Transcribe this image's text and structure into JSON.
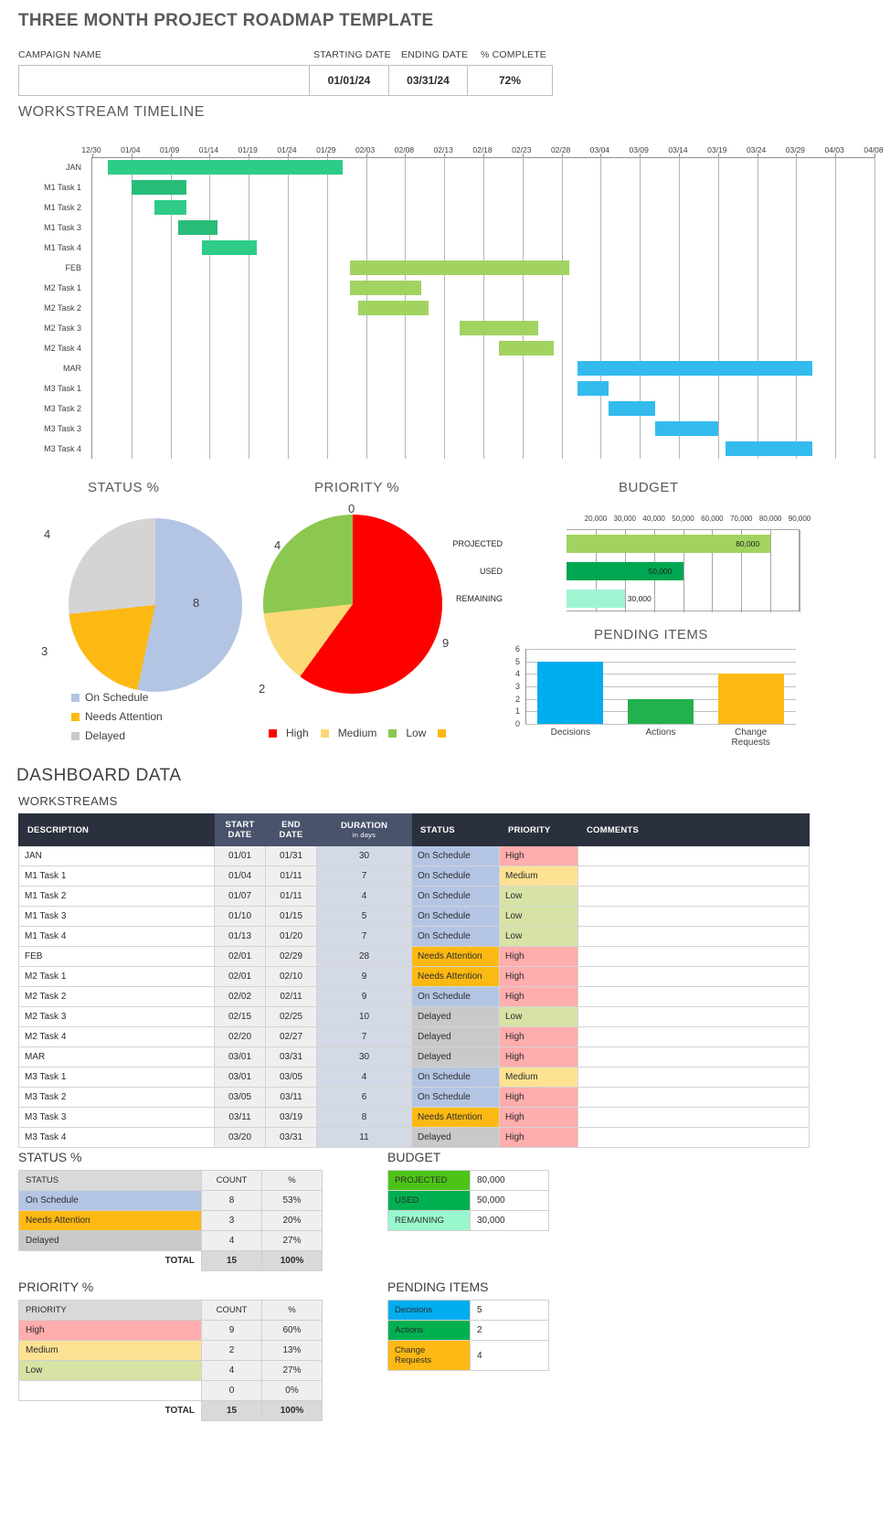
{
  "header": {
    "title": "THREE MONTH PROJECT ROADMAP TEMPLATE",
    "campaign_label": "CAMPAIGN NAME",
    "campaign_value": "",
    "start_label": "STARTING DATE",
    "start_value": "01/01/24",
    "end_label": "ENDING DATE",
    "end_value": "03/31/24",
    "pct_label": "% COMPLETE",
    "pct_value": "72%"
  },
  "workstream_timeline": {
    "title": "WORKSTREAM TIMELINE"
  },
  "dashboard": {
    "title": "DASHBOARD DATA",
    "workstreams_label": "WORKSTREAMS"
  },
  "workstreams_table": {
    "columns": [
      "DESCRIPTION",
      "START DATE",
      "END DATE",
      "DURATION",
      "STATUS",
      "PRIORITY",
      "COMMENTS"
    ],
    "duration_sub": "in days",
    "rows": [
      {
        "desc": "JAN",
        "start": "01/01",
        "end": "01/31",
        "dur": "30",
        "status": "On Schedule",
        "priority": "High",
        "comments": ""
      },
      {
        "desc": "M1 Task 1",
        "start": "01/04",
        "end": "01/11",
        "dur": "7",
        "status": "On Schedule",
        "priority": "Medium",
        "comments": ""
      },
      {
        "desc": "M1 Task 2",
        "start": "01/07",
        "end": "01/11",
        "dur": "4",
        "status": "On Schedule",
        "priority": "Low",
        "comments": ""
      },
      {
        "desc": "M1 Task 3",
        "start": "01/10",
        "end": "01/15",
        "dur": "5",
        "status": "On Schedule",
        "priority": "Low",
        "comments": ""
      },
      {
        "desc": "M1 Task 4",
        "start": "01/13",
        "end": "01/20",
        "dur": "7",
        "status": "On Schedule",
        "priority": "Low",
        "comments": ""
      },
      {
        "desc": "FEB",
        "start": "02/01",
        "end": "02/29",
        "dur": "28",
        "status": "Needs Attention",
        "priority": "High",
        "comments": ""
      },
      {
        "desc": "M2 Task 1",
        "start": "02/01",
        "end": "02/10",
        "dur": "9",
        "status": "Needs Attention",
        "priority": "High",
        "comments": ""
      },
      {
        "desc": "M2 Task 2",
        "start": "02/02",
        "end": "02/11",
        "dur": "9",
        "status": "On Schedule",
        "priority": "High",
        "comments": ""
      },
      {
        "desc": "M2 Task 3",
        "start": "02/15",
        "end": "02/25",
        "dur": "10",
        "status": "Delayed",
        "priority": "Low",
        "comments": ""
      },
      {
        "desc": "M2 Task 4",
        "start": "02/20",
        "end": "02/27",
        "dur": "7",
        "status": "Delayed",
        "priority": "High",
        "comments": ""
      },
      {
        "desc": "MAR",
        "start": "03/01",
        "end": "03/31",
        "dur": "30",
        "status": "Delayed",
        "priority": "High",
        "comments": ""
      },
      {
        "desc": "M3 Task 1",
        "start": "03/01",
        "end": "03/05",
        "dur": "4",
        "status": "On Schedule",
        "priority": "Medium",
        "comments": ""
      },
      {
        "desc": "M3 Task 2",
        "start": "03/05",
        "end": "03/11",
        "dur": "6",
        "status": "On Schedule",
        "priority": "High",
        "comments": ""
      },
      {
        "desc": "M3 Task 3",
        "start": "03/11",
        "end": "03/19",
        "dur": "8",
        "status": "Needs Attention",
        "priority": "High",
        "comments": ""
      },
      {
        "desc": "M3 Task 4",
        "start": "03/20",
        "end": "03/31",
        "dur": "11",
        "status": "Delayed",
        "priority": "High",
        "comments": ""
      }
    ]
  },
  "status_table": {
    "title": "STATUS %",
    "columns": [
      "STATUS",
      "COUNT",
      "%"
    ],
    "rows": [
      {
        "label": "On Schedule",
        "count": "8",
        "pct": "53%",
        "color": "#b4c5e4"
      },
      {
        "label": "Needs Attention",
        "count": "3",
        "pct": "20%",
        "color": "#fdb913"
      },
      {
        "label": "Delayed",
        "count": "4",
        "pct": "27%",
        "color": "#c9c9c9"
      }
    ],
    "total_label": "TOTAL",
    "total_count": "15",
    "total_pct": "100%"
  },
  "priority_table": {
    "title": "PRIORITY %",
    "columns": [
      "PRIORITY",
      "COUNT",
      "%"
    ],
    "rows": [
      {
        "label": "High",
        "count": "9",
        "pct": "60%",
        "color": "#ffadad"
      },
      {
        "label": "Medium",
        "count": "2",
        "pct": "13%",
        "color": "#fde293"
      },
      {
        "label": "Low",
        "count": "4",
        "pct": "27%",
        "color": "#d6e3a5"
      },
      {
        "label": "",
        "count": "0",
        "pct": "0%",
        "color": "#ffffff"
      }
    ],
    "total_label": "TOTAL",
    "total_count": "15",
    "total_pct": "100%"
  },
  "budget_table": {
    "title": "BUDGET",
    "rows": [
      {
        "label": "PROJECTED",
        "value": "80,000",
        "color": "#4cc417"
      },
      {
        "label": "USED",
        "value": "50,000",
        "color": "#00b050"
      },
      {
        "label": "REMAINING",
        "value": "30,000",
        "color": "#99f7cd"
      }
    ]
  },
  "pending_table": {
    "title": "PENDING ITEMS",
    "rows": [
      {
        "label": "Decisions",
        "value": "5",
        "color": "#00adef"
      },
      {
        "label": "Actions",
        "value": "2",
        "color": "#00b050"
      },
      {
        "label": "Change Requests",
        "value": "4",
        "color": "#fdb913"
      }
    ]
  },
  "chart_data": [
    {
      "type": "bar",
      "name": "workstream-timeline-gantt",
      "title": "WORKSTREAM TIMELINE",
      "orientation": "horizontal-gantt",
      "xlabel": "",
      "ylabel": "",
      "axis_ticks": [
        "12/30",
        "01/04",
        "01/09",
        "01/14",
        "01/19",
        "01/24",
        "01/29",
        "02/03",
        "02/08",
        "02/13",
        "02/18",
        "02/23",
        "02/28",
        "03/04",
        "03/09",
        "03/14",
        "03/19",
        "03/24",
        "03/29",
        "04/03",
        "04/08"
      ],
      "axis_start": "12/30",
      "axis_end": "04/08",
      "axis_day_span": 100,
      "grid": true,
      "categories": [
        "JAN",
        "M1 Task 1",
        "M1 Task 2",
        "M1 Task 3",
        "M1 Task 4",
        "FEB",
        "M2 Task 1",
        "M2 Task 2",
        "M2 Task 3",
        "M2 Task 4",
        "MAR",
        "M3 Task 1",
        "M3 Task 2",
        "M3 Task 3",
        "M3 Task 4"
      ],
      "bars": [
        {
          "label": "JAN",
          "start_day": 2,
          "duration": 30,
          "color": "#2ecc86"
        },
        {
          "label": "M1 Task 1",
          "start_day": 5,
          "duration": 7,
          "color": "#27bd78"
        },
        {
          "label": "M1 Task 2",
          "start_day": 8,
          "duration": 4,
          "color": "#2ecc86"
        },
        {
          "label": "M1 Task 3",
          "start_day": 11,
          "duration": 5,
          "color": "#27bd78"
        },
        {
          "label": "M1 Task 4",
          "start_day": 14,
          "duration": 7,
          "color": "#2ecc86"
        },
        {
          "label": "FEB",
          "start_day": 33,
          "duration": 28,
          "color": "#a2d360"
        },
        {
          "label": "M2 Task 1",
          "start_day": 33,
          "duration": 9,
          "color": "#a2d360"
        },
        {
          "label": "M2 Task 2",
          "start_day": 34,
          "duration": 9,
          "color": "#a2d360"
        },
        {
          "label": "M2 Task 3",
          "start_day": 47,
          "duration": 10,
          "color": "#a2d360"
        },
        {
          "label": "M2 Task 4",
          "start_day": 52,
          "duration": 7,
          "color": "#a2d360"
        },
        {
          "label": "MAR",
          "start_day": 62,
          "duration": 30,
          "color": "#33bbed"
        },
        {
          "label": "M3 Task 1",
          "start_day": 62,
          "duration": 4,
          "color": "#33bbed"
        },
        {
          "label": "M3 Task 2",
          "start_day": 66,
          "duration": 6,
          "color": "#33bbed"
        },
        {
          "label": "M3 Task 3",
          "start_day": 72,
          "duration": 8,
          "color": "#33bbed"
        },
        {
          "label": "M3 Task 4",
          "start_day": 81,
          "duration": 11,
          "color": "#33bbed"
        }
      ]
    },
    {
      "type": "pie",
      "name": "status-pie",
      "title": "STATUS %",
      "labels": [
        "On Schedule",
        "Needs Attention",
        "Delayed"
      ],
      "values": [
        8,
        3,
        4
      ],
      "colors": [
        "#b4c5e4",
        "#fdb913",
        "#d4d4d4"
      ],
      "legend_position": "bottom"
    },
    {
      "type": "pie",
      "name": "priority-pie",
      "title": "PRIORITY %",
      "labels": [
        "High",
        "Medium",
        "Low",
        ""
      ],
      "values": [
        9,
        2,
        4,
        0
      ],
      "colors": [
        "#fe0000",
        "#fbd976",
        "#8cc751",
        "#fdb913"
      ],
      "legend_position": "bottom"
    },
    {
      "type": "bar",
      "name": "budget-bar",
      "title": "BUDGET",
      "orientation": "horizontal",
      "categories": [
        "PROJECTED",
        "USED",
        "REMAINING"
      ],
      "values": [
        80000,
        50000,
        30000
      ],
      "value_labels": [
        "80,000",
        "50,000",
        "30,000"
      ],
      "colors": [
        "#a2d360",
        "#00a651",
        "#9ff5d2"
      ],
      "xticks": [
        "20,000",
        "30,000",
        "40,000",
        "50,000",
        "60,000",
        "70,000",
        "80,000",
        "90,000"
      ],
      "xlim": [
        10000,
        90000
      ],
      "grid": true
    },
    {
      "type": "bar",
      "name": "pending-items-bar",
      "title": "PENDING ITEMS",
      "orientation": "vertical",
      "categories": [
        "Decisions",
        "Actions",
        "Change Requests"
      ],
      "values": [
        5,
        2,
        4
      ],
      "colors": [
        "#00adef",
        "#22b14c",
        "#fdb913"
      ],
      "yticks": [
        "0",
        "1",
        "2",
        "3",
        "4",
        "5",
        "6"
      ],
      "ylim": [
        0,
        6
      ],
      "grid": true
    }
  ],
  "pie_labels": {
    "status": [
      "8",
      "3",
      "4"
    ],
    "priority": [
      "0",
      "9",
      "2",
      "4"
    ]
  },
  "legends": {
    "status": [
      "On Schedule",
      "Needs Attention",
      "Delayed"
    ],
    "priority": [
      "High",
      "Medium",
      "Low"
    ]
  }
}
